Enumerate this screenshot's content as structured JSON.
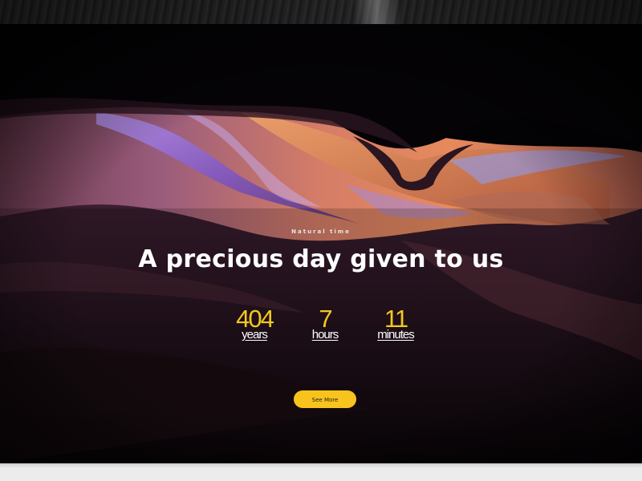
{
  "hero": {
    "eyebrow": "Natural time",
    "headline": "A precious day given to us",
    "counters": [
      {
        "value": "404",
        "unit": "years"
      },
      {
        "value": "7",
        "unit": "hours"
      },
      {
        "value": "11",
        "unit": "minutes"
      }
    ],
    "button_label": "See More"
  },
  "colors": {
    "accent": "#f7c31c",
    "counter_number": "#f2c81e",
    "background": "#000000"
  }
}
